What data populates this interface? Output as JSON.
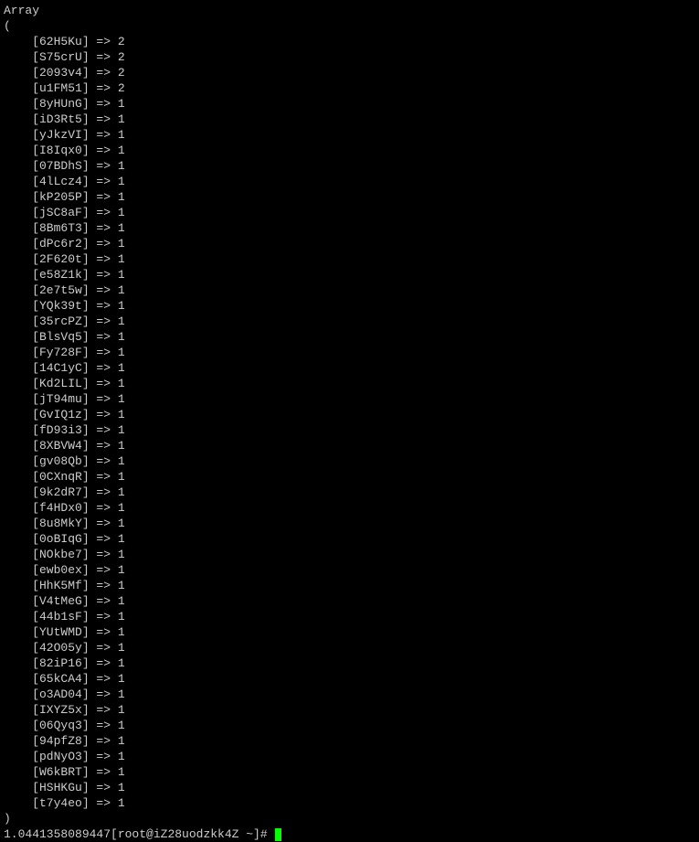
{
  "array_label": "Array",
  "open_paren": "(",
  "close_paren": ")",
  "entries": [
    {
      "key": "62H5Ku",
      "value": "2"
    },
    {
      "key": "S75crU",
      "value": "2"
    },
    {
      "key": "2093v4",
      "value": "2"
    },
    {
      "key": "u1FM51",
      "value": "2"
    },
    {
      "key": "8yHUnG",
      "value": "1"
    },
    {
      "key": "iD3Rt5",
      "value": "1"
    },
    {
      "key": "yJkzVI",
      "value": "1"
    },
    {
      "key": "I8Iqx0",
      "value": "1"
    },
    {
      "key": "07BDhS",
      "value": "1"
    },
    {
      "key": "4lLcz4",
      "value": "1"
    },
    {
      "key": "kP205P",
      "value": "1"
    },
    {
      "key": "jSC8aF",
      "value": "1"
    },
    {
      "key": "8Bm6T3",
      "value": "1"
    },
    {
      "key": "dPc6r2",
      "value": "1"
    },
    {
      "key": "2F620t",
      "value": "1"
    },
    {
      "key": "e58Z1k",
      "value": "1"
    },
    {
      "key": "2e7t5w",
      "value": "1"
    },
    {
      "key": "YQk39t",
      "value": "1"
    },
    {
      "key": "35rcPZ",
      "value": "1"
    },
    {
      "key": "BlsVq5",
      "value": "1"
    },
    {
      "key": "Fy728F",
      "value": "1"
    },
    {
      "key": "14C1yC",
      "value": "1"
    },
    {
      "key": "Kd2LIL",
      "value": "1"
    },
    {
      "key": "jT94mu",
      "value": "1"
    },
    {
      "key": "GvIQ1z",
      "value": "1"
    },
    {
      "key": "fD93i3",
      "value": "1"
    },
    {
      "key": "8XBVW4",
      "value": "1"
    },
    {
      "key": "gv08Qb",
      "value": "1"
    },
    {
      "key": "0CXnqR",
      "value": "1"
    },
    {
      "key": "9k2dR7",
      "value": "1"
    },
    {
      "key": "f4HDx0",
      "value": "1"
    },
    {
      "key": "8u8MkY",
      "value": "1"
    },
    {
      "key": "0oBIqG",
      "value": "1"
    },
    {
      "key": "NOkbe7",
      "value": "1"
    },
    {
      "key": "ewb0ex",
      "value": "1"
    },
    {
      "key": "HhK5Mf",
      "value": "1"
    },
    {
      "key": "V4tMeG",
      "value": "1"
    },
    {
      "key": "44b1sF",
      "value": "1"
    },
    {
      "key": "YUtWMD",
      "value": "1"
    },
    {
      "key": "42O05y",
      "value": "1"
    },
    {
      "key": "82iP16",
      "value": "1"
    },
    {
      "key": "65kCA4",
      "value": "1"
    },
    {
      "key": "o3AD04",
      "value": "1"
    },
    {
      "key": "IXYZ5x",
      "value": "1"
    },
    {
      "key": "06Qyq3",
      "value": "1"
    },
    {
      "key": "94pfZ8",
      "value": "1"
    },
    {
      "key": "pdNyO3",
      "value": "1"
    },
    {
      "key": "W6kBRT",
      "value": "1"
    },
    {
      "key": "HSHKGu",
      "value": "1"
    },
    {
      "key": "t7y4eo",
      "value": "1"
    }
  ],
  "timing_value": "1.0441358089447",
  "prompt": "[root@iZ28uodzkk4Z ~]# "
}
